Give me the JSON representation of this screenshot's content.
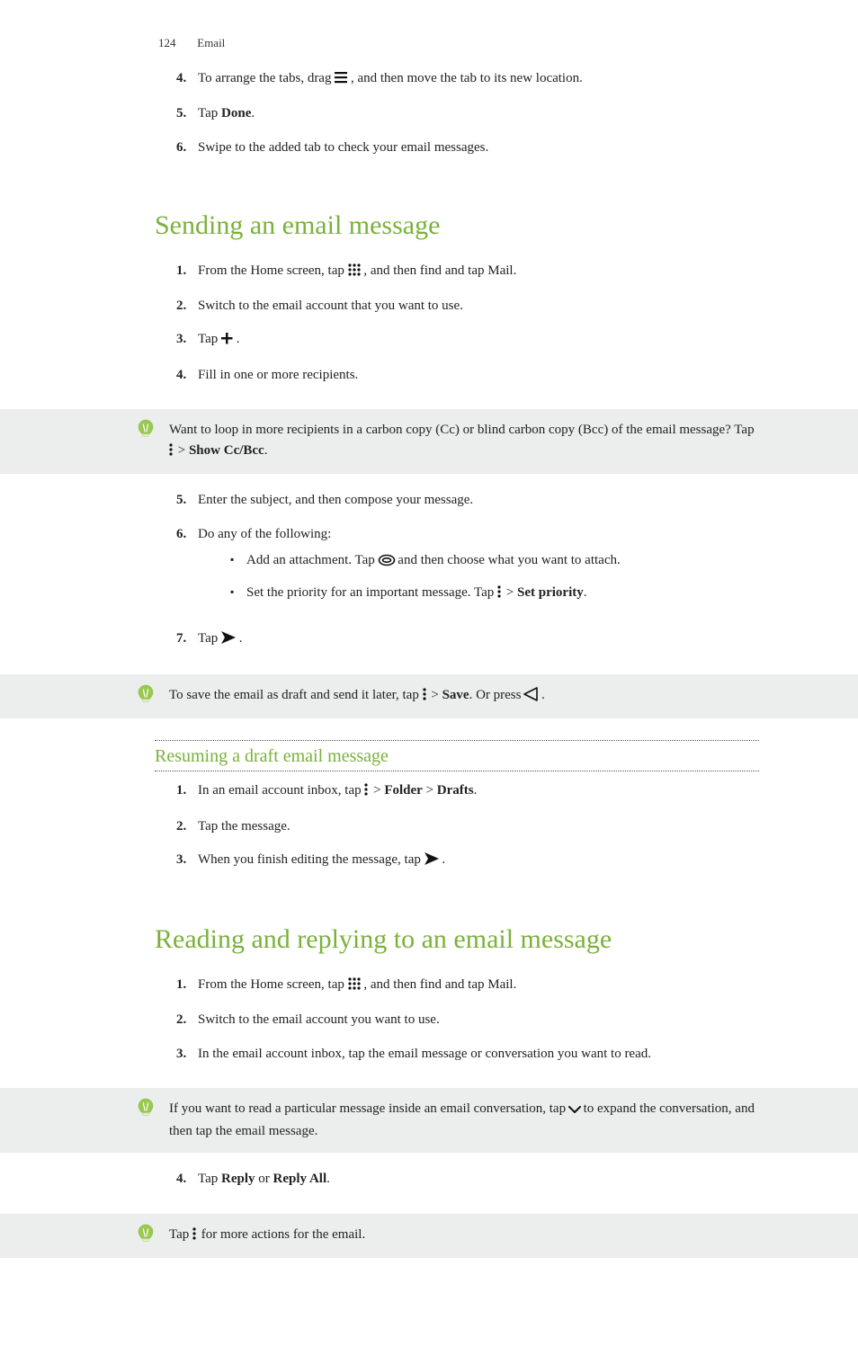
{
  "header": {
    "page_number": "124",
    "chapter": "Email"
  },
  "sec0": {
    "step4_a": "To arrange the tabs, drag ",
    "step4_b": " , and then move the tab to its new location.",
    "step5_a": "Tap ",
    "step5_bold": "Done",
    "step5_b": ".",
    "step6": "Swipe to the added tab to check your email messages."
  },
  "sec1": {
    "title": "Sending an email message",
    "step1_a": "From the Home screen, tap ",
    "step1_b": " , and then find and tap Mail.",
    "step2": "Switch to the email account that you want to use.",
    "step3_a": "Tap ",
    "step3_b": " .",
    "step4": "Fill in one or more recipients.",
    "tip1_a": "Want to loop in more recipients in a carbon copy (Cc) or blind carbon copy (Bcc) of the email message? Tap ",
    "tip1_gt": " > ",
    "tip1_bold": "Show Cc/Bcc",
    "tip1_b": ".",
    "step5": "Enter the subject, and then compose your message.",
    "step6": "Do any of the following:",
    "bul1_a": "Add an attachment. Tap ",
    "bul1_b": " and then choose what you want to attach.",
    "bul2_a": "Set the priority for an important message. Tap ",
    "bul2_gt": " > ",
    "bul2_bold": "Set priority",
    "bul2_b": ".",
    "step7_a": "Tap ",
    "step7_b": " .",
    "tip2_a": "To save the email as draft and send it later, tap ",
    "tip2_gt": " > ",
    "tip2_bold": "Save",
    "tip2_mid": ". Or press ",
    "tip2_b": " ."
  },
  "sec2": {
    "title": "Resuming a draft email message",
    "step1_a": "In an email account inbox, tap ",
    "step1_gt1": " > ",
    "step1_bold1": "Folder",
    "step1_gt2": " > ",
    "step1_bold2": "Drafts",
    "step1_b": ".",
    "step2": "Tap the message.",
    "step3_a": "When you finish editing the message, tap ",
    "step3_b": " ."
  },
  "sec3": {
    "title": "Reading and replying to an email message",
    "step1_a": "From the Home screen, tap ",
    "step1_b": " , and then find and tap Mail.",
    "step2": "Switch to the email account you want to use.",
    "step3": "In the email account inbox, tap the email message or conversation you want to read.",
    "tip1_a": "If you want to read a particular message inside an email conversation, tap ",
    "tip1_b": " to expand the conversation, and then tap the email message.",
    "step4_a": "Tap ",
    "step4_bold1": "Reply",
    "step4_mid": " or ",
    "step4_bold2": "Reply All",
    "step4_b": ".",
    "tip2_a": "Tap ",
    "tip2_b": " for more actions for the email."
  }
}
